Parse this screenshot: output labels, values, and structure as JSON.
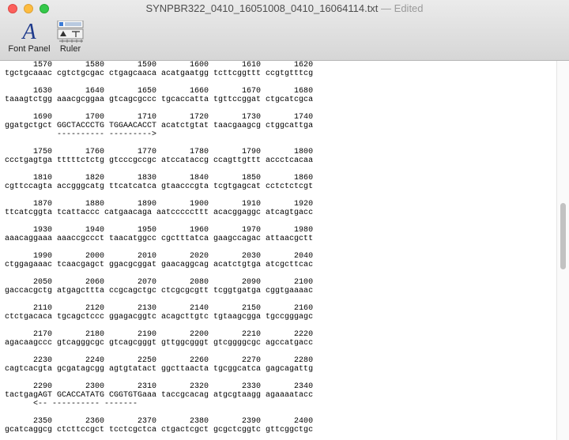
{
  "window": {
    "title": "SYNPBR322_0410_16051008_0410_16064114.txt",
    "edited": "— Edited"
  },
  "toolbar": {
    "font_panel_label": "Font Panel",
    "font_panel_glyph": "A",
    "ruler_label": "Ruler"
  },
  "icons": [
    "close-icon",
    "minimize-icon",
    "zoom-icon",
    "font-panel-icon",
    "ruler-icon"
  ],
  "document": {
    "text": "      1570       1580       1590       1600       1610       1620\ntgctgcaaac cgtctgcgac ctgagcaaca acatgaatgg tcttcggttt ccgtgtttcg\n\n      1630       1640       1650       1660       1670       1680\ntaaagtctgg aaacgcggaa gtcagcgccc tgcaccatta tgttccggat ctgcatcgca\n\n      1690       1700       1710       1720       1730       1740\nggatgctgct GGCTACCCTG TGGAACACCT acatctgtat taacgaagcg ctggcattga\n           ---------- --------->\n\n      1750       1760       1770       1780       1790       1800\nccctgagtga tttttctctg gtcccgccgc atccataccg ccagttgttt accctcacaa\n\n      1810       1820       1830       1840       1850       1860\ncgttccagta accgggcatg ttcatcatca gtaacccgta tcgtgagcat cctctctcgt\n\n      1870       1880       1890       1900       1910       1920\nttcatcggta tcattaccc catgaacaga aatcccccttt acacggaggc atcagtgacc\n\n      1930       1940       1950       1960       1970       1980\naaacaggaaa aaaccgccct taacatggcc cgctttatca gaagccagac attaacgctt\n\n      1990       2000       2010       2020       2030       2040\nctggagaaac tcaacgagct ggacgcggat gaacaggcag acatctgtga atcgcttcac\n\n      2050       2060       2070       2080       2090       2100\ngaccacgctg atgagcttta ccgcagctgc ctcgcgcgtt tcggtgatga cggtgaaaac\n\n      2110       2120       2130       2140       2150       2160\nctctgacaca tgcagctccc ggagacggtc acagcttgtc tgtaagcgga tgccgggagc\n\n      2170       2180       2190       2200       2210       2220\nagacaagccc gtcagggcgc gtcagcgggt gttggcgggt gtcggggcgc agccatgacc\n\n      2230       2240       2250       2260       2270       2280\ncagtcacgta gcgatagcgg agtgtatact ggcttaacta tgcggcatca gagcagattg\n\n      2290       2300       2310       2320       2330       2340\ntactgagAGT GCACCATATG CGGTGTGaaa taccgcacag atgcgtaagg agaaaatacc\n      <-- ---------- -------\n\n      2350       2360       2370       2380       2390       2400\ngcatcaggcg ctcttccgct tcctcgctca ctgactcgct gcgctcggtc gttcggctgc"
  }
}
